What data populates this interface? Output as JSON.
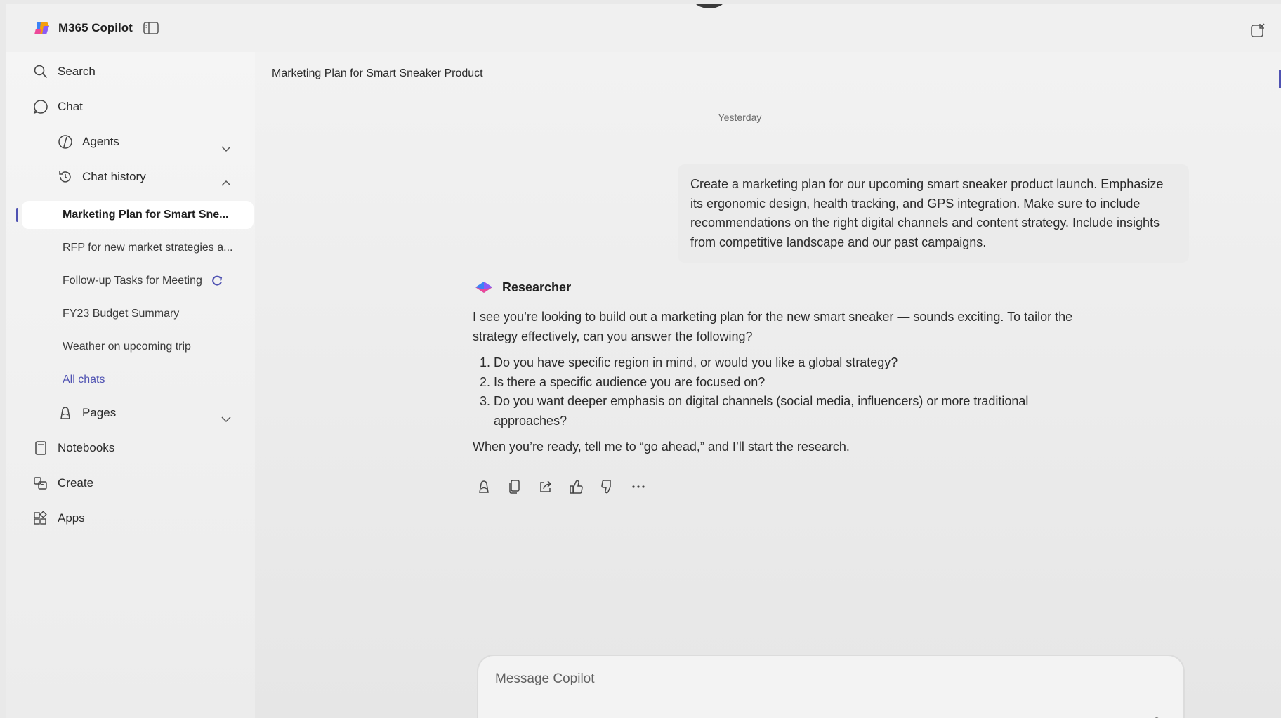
{
  "app": {
    "title": "M365 Copilot"
  },
  "sidebar": {
    "search": "Search",
    "chat": "Chat",
    "agents": "Agents",
    "chat_history": "Chat history",
    "history": [
      "Marketing Plan for Smart Sne...",
      "RFP for new market strategies a...",
      "Follow-up Tasks for Meeting",
      "FY23 Budget Summary",
      "Weather on upcoming trip"
    ],
    "all_chats": "All chats",
    "pages": "Pages",
    "notebooks": "Notebooks",
    "create": "Create",
    "apps": "Apps"
  },
  "conversation": {
    "title": "Marketing Plan for Smart Sneaker Product",
    "date": "Yesterday",
    "user_message": "Create a marketing plan for our upcoming smart sneaker product launch. Emphasize its ergonomic design, health tracking, and GPS integration. Make sure to include recommendations on the right digital channels and content strategy. Include insights from competitive landscape and our past campaigns.",
    "agent_name": "Researcher",
    "agent_intro": "I see you’re looking to build out a marketing plan for the new smart sneaker — sounds exciting. To tailor the strategy effectively, can you answer the following?",
    "agent_questions": [
      "Do you have specific region in mind, or would you like a global strategy?",
      "Is there a specific audience you are focused on?",
      "Do you want deeper emphasis on digital channels (social media, influencers) or more traditional approaches?"
    ],
    "agent_outro": "When you’re ready, tell me to “go ahead,” and I’ll start the research."
  },
  "composer": {
    "placeholder": "Message Copilot"
  },
  "colors": {
    "accent": "#4f52b2",
    "active_bg": "#ffffff"
  }
}
